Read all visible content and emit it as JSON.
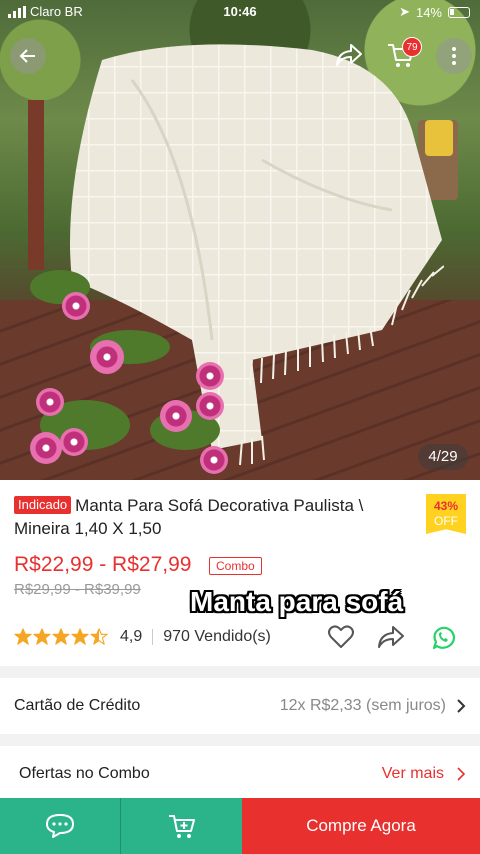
{
  "status_bar": {
    "carrier": "Claro BR",
    "time": "10:46",
    "battery": "14%"
  },
  "gallery": {
    "cart_count": "79",
    "counter": "4/29"
  },
  "product": {
    "tag": "Indicado",
    "title": "Manta Para Sofá  Decorativa Paulista \\ Mineira 1,40 X 1,50",
    "discount_pct": "43%",
    "discount_label": "OFF",
    "price_range": "R$22,99 - R$27,99",
    "combo_tag": "Combo",
    "old_price": "R$29,99 - R$39,99",
    "rating": "4,9",
    "rating_value": 4.5,
    "sold": "970 Vendido(s)"
  },
  "caption": "Manta para sofá",
  "credit_row": {
    "label": "Cartão de Crédito",
    "value": "12x R$2,33 (sem juros)"
  },
  "combo_row": {
    "label": "Ofertas no Combo",
    "link": "Ver mais"
  },
  "bottom_bar": {
    "buy_label": "Compre Agora"
  },
  "colors": {
    "accent": "#e8312f",
    "green": "#2bb38a",
    "star": "#f5a623",
    "badge": "#ffd21f",
    "whatsapp": "#25d366"
  }
}
